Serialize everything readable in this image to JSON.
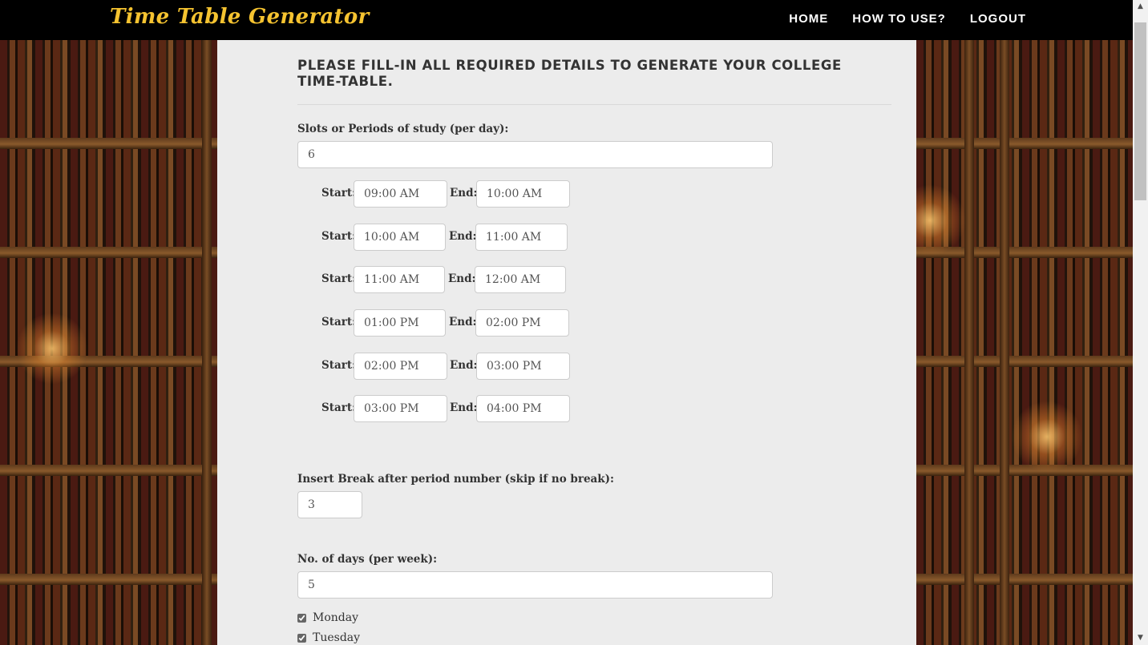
{
  "navbar": {
    "brand": "Time Table Generator",
    "links": [
      "HOME",
      "HOW TO USE?",
      "LOGOUT"
    ]
  },
  "form": {
    "title": "PLEASE FILL-IN ALL REQUIRED DETAILS TO GENERATE YOUR COLLEGE TIME-TABLE.",
    "slots_label": "Slots or Periods of study (per day):",
    "slots_value": "6",
    "start_label": "Start:",
    "end_label": "End:",
    "slots": [
      {
        "start": "09:00 AM",
        "end": "10:00 AM"
      },
      {
        "start": "10:00 AM",
        "end": "11:00 AM"
      },
      {
        "start": "11:00 AM",
        "end": "12:00 AM"
      },
      {
        "start": "01:00 PM",
        "end": "02:00 PM"
      },
      {
        "start": "02:00 PM",
        "end": "03:00 PM"
      },
      {
        "start": "03:00 PM",
        "end": "04:00 PM"
      }
    ],
    "break_label": "Insert Break after period number (skip if no break):",
    "break_value": "3",
    "days_label": "No. of days (per week):",
    "days_value": "5",
    "days": [
      {
        "name": "Monday",
        "checked": true
      },
      {
        "name": "Tuesday",
        "checked": true
      }
    ]
  }
}
